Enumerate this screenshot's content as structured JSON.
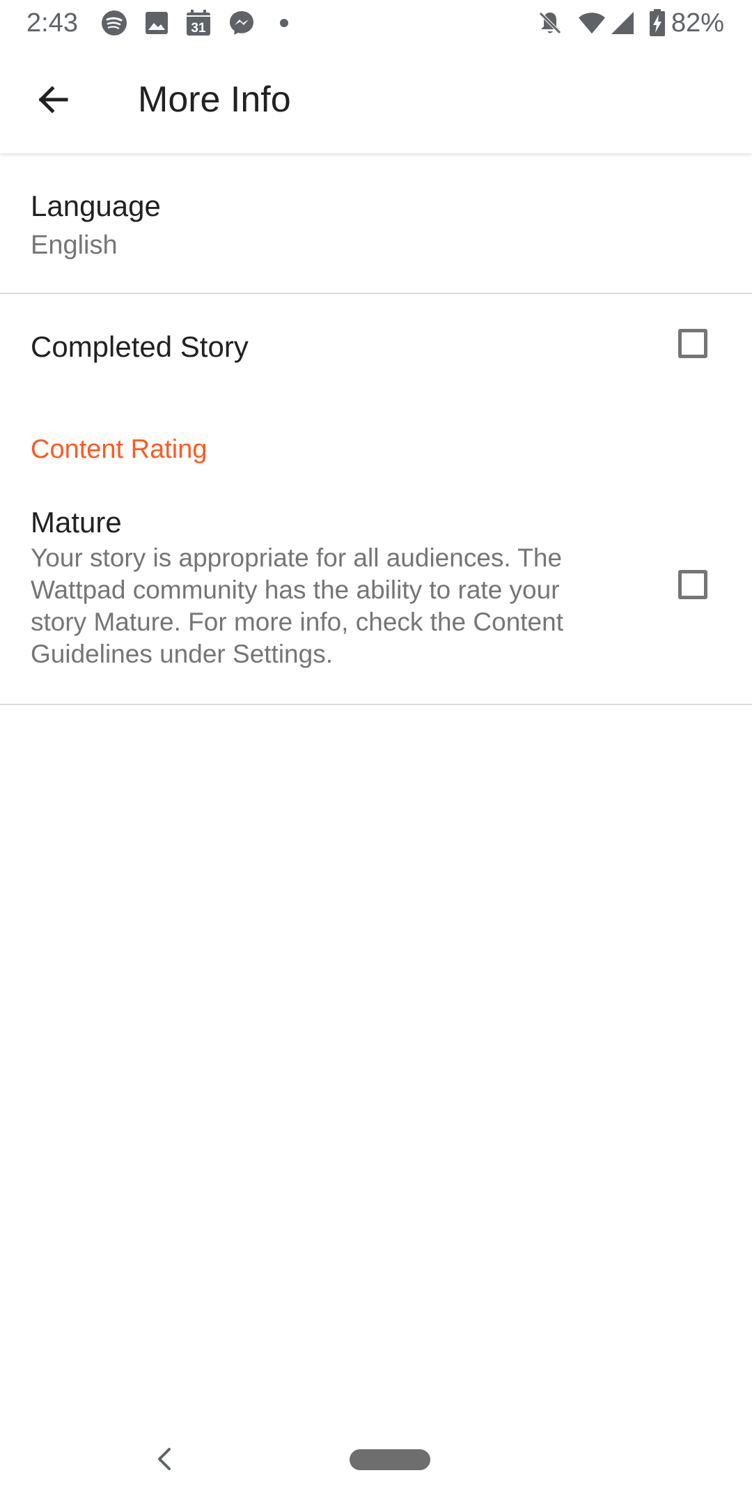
{
  "status_bar": {
    "time": "2:43",
    "battery_percent": "82%",
    "notification_icons": [
      "spotify-icon",
      "image-icon",
      "calendar-icon",
      "messenger-icon",
      "dot-icon"
    ],
    "calendar_day": "31",
    "system_icons": [
      "notifications-off-icon",
      "wifi-icon",
      "signal-icon",
      "battery-charging-icon"
    ]
  },
  "app_bar": {
    "title": "More Info",
    "back_icon": "arrow-back-icon"
  },
  "settings": {
    "language": {
      "label": "Language",
      "value": "English"
    },
    "completed_story": {
      "label": "Completed Story",
      "checked": false
    },
    "content_rating": {
      "header": "Content Rating",
      "mature": {
        "label": "Mature",
        "description": "Your story is appropriate for all audiences. The Wattpad community has the ability to rate your story Mature. For more info, check the Content Guidelines under Settings.",
        "checked": false
      }
    }
  },
  "colors": {
    "accent": "#ff5a1f",
    "primary_text": "#212121",
    "secondary_text": "#757575",
    "divider": "#dcdcdc"
  },
  "nav_bar": {
    "back_icon": "chevron-left-icon",
    "home_icon": "home-pill-icon"
  }
}
